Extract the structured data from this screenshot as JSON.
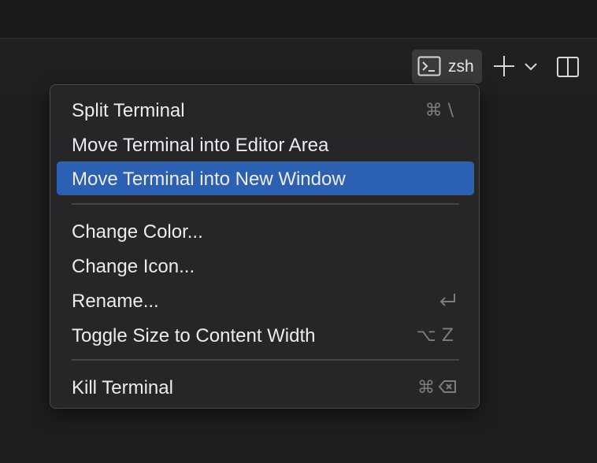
{
  "terminal_tab": {
    "label": "zsh",
    "icon": "terminal-icon"
  },
  "toolbar": {
    "new_terminal_icon": "plus-icon",
    "dropdown_icon": "chevron-down-icon",
    "split_icon": "split-editor-icon"
  },
  "menu": {
    "group1": [
      {
        "label": "Split Terminal",
        "shortcut": "⌘ \\"
      },
      {
        "label": "Move Terminal into Editor Area",
        "shortcut": ""
      },
      {
        "label": "Move Terminal into New Window",
        "shortcut": "",
        "highlighted": true
      }
    ],
    "group2": [
      {
        "label": "Change Color...",
        "shortcut": ""
      },
      {
        "label": "Change Icon...",
        "shortcut": ""
      },
      {
        "label": "Rename...",
        "shortcut_icon": "return-key-icon"
      },
      {
        "label": "Toggle Size to Content Width",
        "shortcut": "⌥ Z"
      }
    ],
    "group3": [
      {
        "label": "Kill Terminal",
        "shortcut": "⌘",
        "shortcut_icon": "delete-key-icon"
      }
    ]
  },
  "colors": {
    "highlight": "#2c60b3",
    "menu_bg": "#262629",
    "background": "#1e1e1e"
  }
}
